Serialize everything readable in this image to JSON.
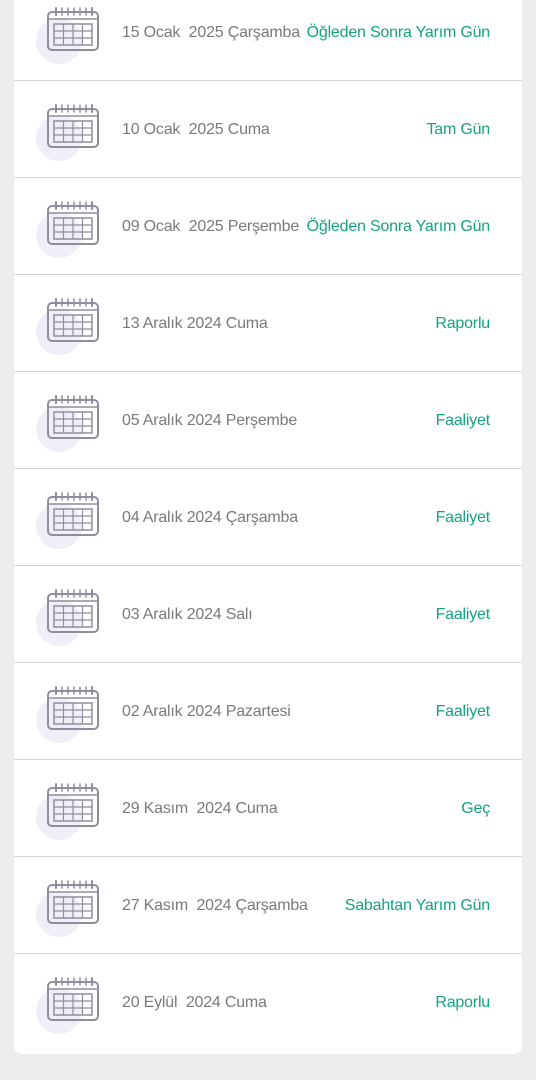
{
  "colors": {
    "background": "#ececec",
    "card": "#ffffff",
    "divider": "#d3d3d3",
    "date_text": "#7a7a7a",
    "status_text": "#14a37f",
    "icon_stroke": "#8e8e9e",
    "icon_circle": "#efeff8"
  },
  "items": [
    {
      "date": "15 Ocak  2025 Çarşamba",
      "status": "Öğleden Sonra Yarım Gün",
      "icon": "calendar-icon"
    },
    {
      "date": "10 Ocak  2025 Cuma",
      "status": "Tam Gün",
      "icon": "calendar-icon"
    },
    {
      "date": "09 Ocak  2025 Perşembe",
      "status": "Öğleden Sonra Yarım Gün",
      "icon": "calendar-icon"
    },
    {
      "date": "13 Aralık 2024 Cuma",
      "status": "Raporlu",
      "icon": "calendar-icon"
    },
    {
      "date": "05 Aralık 2024 Perşembe",
      "status": "Faaliyet",
      "icon": "calendar-icon"
    },
    {
      "date": "04 Aralık 2024 Çarşamba",
      "status": "Faaliyet",
      "icon": "calendar-icon"
    },
    {
      "date": "03 Aralık 2024 Salı",
      "status": "Faaliyet",
      "icon": "calendar-icon"
    },
    {
      "date": "02 Aralık 2024 Pazartesi",
      "status": "Faaliyet",
      "icon": "calendar-icon"
    },
    {
      "date": "29 Kasım  2024 Cuma",
      "status": "Geç",
      "icon": "calendar-icon"
    },
    {
      "date": "27 Kasım  2024 Çarşamba",
      "status": "Sabahtan Yarım Gün",
      "icon": "calendar-icon"
    },
    {
      "date": "20 Eylül  2024 Cuma",
      "status": "Raporlu",
      "icon": "calendar-icon"
    }
  ]
}
